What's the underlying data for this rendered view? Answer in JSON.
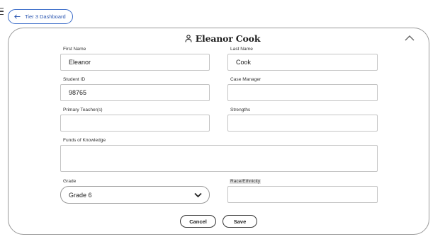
{
  "nav": {
    "back_label": "Tier 3 Dashboard"
  },
  "student": {
    "display_name": "Eleanor Cook"
  },
  "form": {
    "first_name": {
      "label": "First Name",
      "value": "Eleanor"
    },
    "last_name": {
      "label": "Last Name",
      "value": "Cook"
    },
    "student_id": {
      "label": "Student ID",
      "value": "98765"
    },
    "case_manager": {
      "label": "Case Manager",
      "value": ""
    },
    "primary_teacher": {
      "label": "Primary Teacher(s)",
      "value": ""
    },
    "strengths": {
      "label": "Strengths",
      "value": ""
    },
    "funds_of_knowledge": {
      "label": "Funds of Knowledge",
      "value": ""
    },
    "grade": {
      "label": "Grade",
      "value": "Grade 6"
    },
    "race_ethnicity": {
      "label": "Race/Ethnicity",
      "value": ""
    }
  },
  "actions": {
    "cancel_label": "Cancel",
    "save_label": "Save"
  },
  "icons": {
    "menu": "menu-icon",
    "back": "arrow-left-icon",
    "person": "person-icon",
    "collapse": "chevron-up-icon",
    "dropdown": "chevron-down-icon"
  },
  "colors": {
    "accent": "#3b6cc9"
  }
}
